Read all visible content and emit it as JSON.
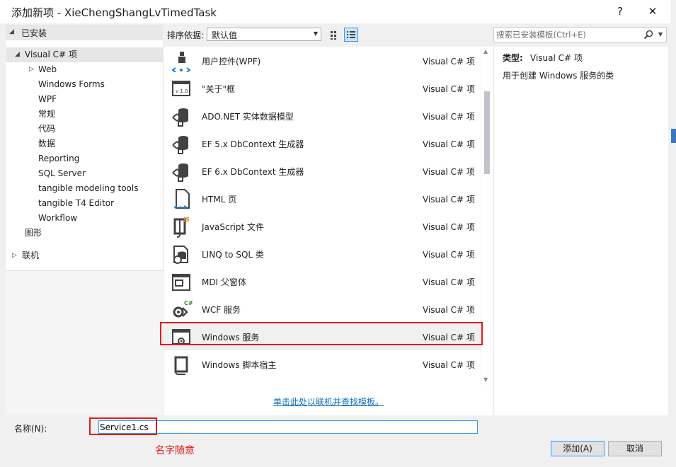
{
  "window": {
    "title": "添加新项 - XieChengShangLvTimedTask",
    "help_label": "?",
    "close_label": "✕"
  },
  "tree": {
    "installed_label": "已安装",
    "items": [
      {
        "label": "Visual C# 项",
        "arrow": "◢"
      },
      {
        "label": "Web",
        "arrow": "▷"
      },
      {
        "label": "Windows Forms"
      },
      {
        "label": "WPF"
      },
      {
        "label": "常规"
      },
      {
        "label": "代码"
      },
      {
        "label": "数据"
      },
      {
        "label": "Reporting"
      },
      {
        "label": "SQL Server"
      },
      {
        "label": "tangible modeling tools"
      },
      {
        "label": "tangible T4 Editor"
      },
      {
        "label": "Workflow"
      },
      {
        "label": "图形"
      }
    ],
    "online_label": "联机"
  },
  "toolbar": {
    "sort_label": "排序依据:",
    "sort_value": "默认值"
  },
  "search": {
    "placeholder": "搜索已安装模板(Ctrl+E)"
  },
  "templates": [
    {
      "name": "用户控件(WPF)",
      "type": "Visual C# 项",
      "icon": "wpf-usercontrol-icon"
    },
    {
      "name": "\"关于\"框",
      "type": "Visual C# 项",
      "icon": "about-box-icon"
    },
    {
      "name": "ADO.NET 实体数据模型",
      "type": "Visual C# 项",
      "icon": "data-model-icon"
    },
    {
      "name": "EF 5.x DbContext 生成器",
      "type": "Visual C# 项",
      "icon": "data-model-icon"
    },
    {
      "name": "EF 6.x DbContext 生成器",
      "type": "Visual C# 项",
      "icon": "data-model-icon"
    },
    {
      "name": "HTML 页",
      "type": "Visual C# 项",
      "icon": "html-page-icon"
    },
    {
      "name": "JavaScript 文件",
      "type": "Visual C# 项",
      "icon": "javascript-file-icon"
    },
    {
      "name": "LINQ to SQL 类",
      "type": "Visual C# 项",
      "icon": "linq-to-sql-icon"
    },
    {
      "name": "MDI 父窗体",
      "type": "Visual C# 项",
      "icon": "mdi-form-icon"
    },
    {
      "name": "WCF 服务",
      "type": "Visual C# 项",
      "icon": "wcf-service-icon"
    },
    {
      "name": "Windows 服务",
      "type": "Visual C# 项",
      "icon": "windows-service-icon",
      "selected": true
    },
    {
      "name": "Windows 脚本宿主",
      "type": "Visual C# 项",
      "icon": "script-host-icon"
    }
  ],
  "online_link": "单击此处以联机并查找模板。",
  "details": {
    "type_label": "类型:",
    "type_value": "Visual C# 项",
    "description": "用于创建 Windows 服务的类"
  },
  "bottom": {
    "name_label": "名称(N):",
    "name_value": "Service1.cs",
    "annotation": "名字随意",
    "add_label": "添加(A)",
    "cancel_label": "取消"
  },
  "colors": {
    "accent": "#3399ff",
    "annotation_red": "#e01b1b",
    "link": "#0e70c0"
  }
}
